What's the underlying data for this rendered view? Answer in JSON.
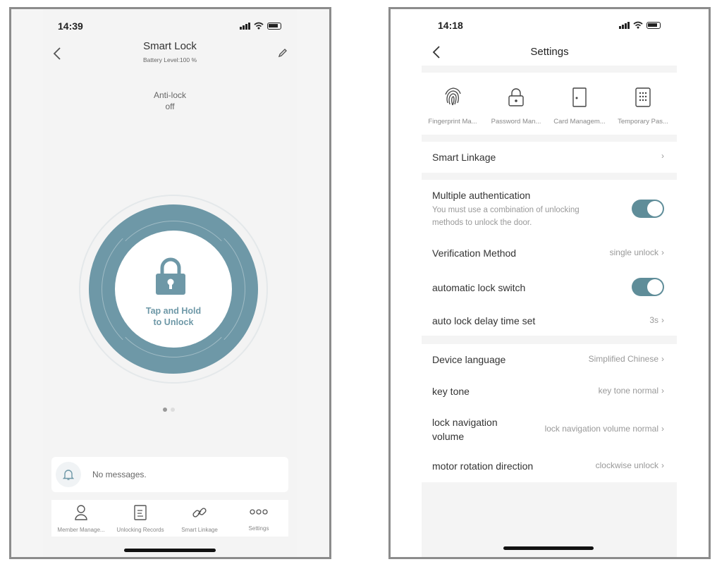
{
  "left": {
    "status_time": "14:39",
    "title": "Smart Lock",
    "battery": "Battery Level:100 %",
    "anti_lock_label": "Anti-lock",
    "anti_lock_value": "off",
    "unlock_line1": "Tap and Hold",
    "unlock_line2": "to Unlock",
    "messages": "No messages.",
    "nav": [
      {
        "label": "Member Manage..."
      },
      {
        "label": "Unlocking Records"
      },
      {
        "label": "Smart Linkage"
      },
      {
        "label": "Settings"
      }
    ],
    "accent": "#6e98a7"
  },
  "right": {
    "status_time": "14:18",
    "title": "Settings",
    "functions": [
      {
        "label": "Fingerprint Ma...",
        "icon": "fingerprint-icon"
      },
      {
        "label": "Password Man...",
        "icon": "padlock-icon"
      },
      {
        "label": "Card Managem...",
        "icon": "door-icon"
      },
      {
        "label": "Temporary Pas...",
        "icon": "keypad-icon"
      }
    ],
    "smart_linkage": "Smart Linkage",
    "multi_auth_title": "Multiple authentication",
    "multi_auth_desc1": "You must use a combination of unlocking",
    "multi_auth_desc2": "methods to unlock the door.",
    "verification_label": "Verification Method",
    "verification_value": "single unlock",
    "auto_lock_label": "automatic lock switch",
    "auto_delay_label": "auto lock delay time set",
    "auto_delay_value": "3s",
    "device_language_label": "Device language",
    "device_language_value": "Simplified Chinese",
    "key_tone_label": "key tone",
    "key_tone_value": "key tone normal",
    "lock_nav_label1": "lock navigation",
    "lock_nav_label2": "volume",
    "lock_nav_value": "lock navigation volume normal",
    "motor_label": "motor rotation direction",
    "motor_value": "clockwise unlock",
    "toggle_color": "#5f8d99"
  }
}
